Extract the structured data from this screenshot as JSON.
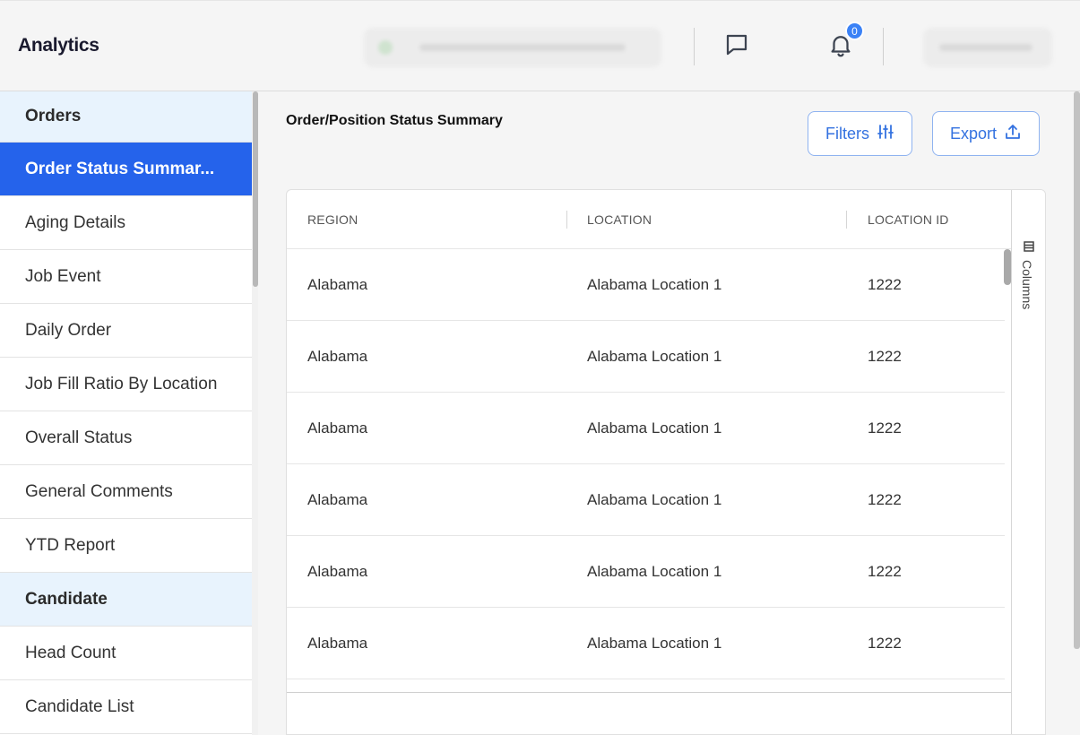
{
  "header": {
    "title": "Analytics",
    "notification_count": "0"
  },
  "sidebar": {
    "items": [
      {
        "label": "Orders",
        "type": "section"
      },
      {
        "label": "Order Status Summar...",
        "type": "active"
      },
      {
        "label": "Aging Details",
        "type": "item"
      },
      {
        "label": "Job Event",
        "type": "item"
      },
      {
        "label": "Daily Order",
        "type": "item"
      },
      {
        "label": "Job Fill Ratio By Location",
        "type": "item"
      },
      {
        "label": "Overall Status",
        "type": "item"
      },
      {
        "label": "General Comments",
        "type": "item"
      },
      {
        "label": "YTD Report",
        "type": "item"
      },
      {
        "label": "Candidate",
        "type": "section"
      },
      {
        "label": "Head Count",
        "type": "item"
      },
      {
        "label": "Candidate List",
        "type": "item"
      }
    ]
  },
  "main": {
    "title": "Order/Position Status Summary",
    "filters_label": "Filters",
    "export_label": "Export",
    "columns_label": "Columns",
    "table": {
      "headers": [
        "REGION",
        "LOCATION",
        "LOCATION ID"
      ],
      "rows": [
        [
          "Alabama",
          "Alabama Location 1",
          "1222"
        ],
        [
          "Alabama",
          "Alabama Location 1",
          "1222"
        ],
        [
          "Alabama",
          "Alabama Location 1",
          "1222"
        ],
        [
          "Alabama",
          "Alabama Location 1",
          "1222"
        ],
        [
          "Alabama",
          "Alabama Location 1",
          "1222"
        ],
        [
          "Alabama",
          "Alabama Location 1",
          "1222"
        ]
      ]
    }
  },
  "colors": {
    "accent": "#2563eb",
    "section_bg": "#e8f3fd",
    "button_text": "#3472e0",
    "badge": "#3b82f6"
  },
  "icons": {
    "chat": "message-square-icon",
    "bell": "bell-icon",
    "filters": "sliders-icon",
    "export": "upload-icon",
    "columns": "columns-icon"
  }
}
